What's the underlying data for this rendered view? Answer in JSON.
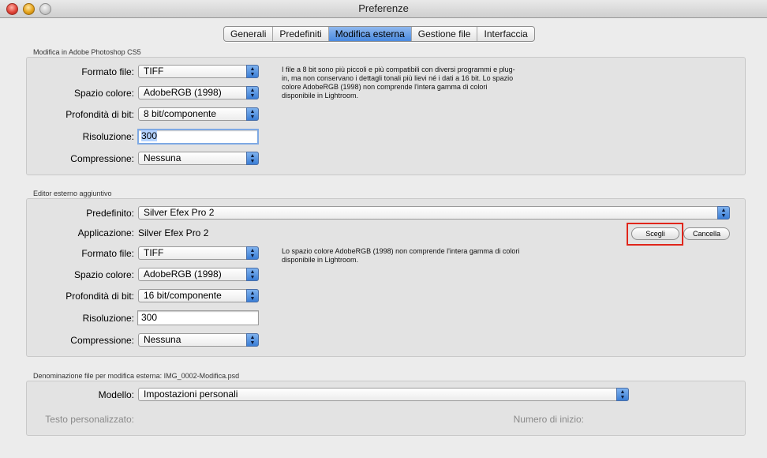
{
  "window": {
    "title": "Preferenze"
  },
  "tabs": [
    {
      "label": "Generali"
    },
    {
      "label": "Predefiniti"
    },
    {
      "label": "Modifica esterna"
    },
    {
      "label": "Gestione file"
    },
    {
      "label": "Interfaccia"
    }
  ],
  "photoshop": {
    "section_title": "Modifica in Adobe Photoshop CS5",
    "format_label": "Formato file:",
    "format_value": "TIFF",
    "colorspace_label": "Spazio colore:",
    "colorspace_value": "AdobeRGB (1998)",
    "depth_label": "Profondità di bit:",
    "depth_value": "8 bit/componente",
    "resolution_label": "Risoluzione:",
    "resolution_value": "300",
    "compression_label": "Compressione:",
    "compression_value": "Nessuna",
    "description": "I file a 8 bit sono più piccoli e più compatibili con diversi programmi e plug-in, ma non conservano i dettagli tonali più lievi né i dati a 16 bit. Lo spazio colore AdobeRGB (1998) non comprende l'intera gamma di colori disponibile in Lightroom."
  },
  "external": {
    "section_title": "Editor esterno aggiuntivo",
    "preset_label": "Predefinito:",
    "preset_value": "Silver Efex Pro 2",
    "application_label": "Applicazione:",
    "application_value": "Silver Efex Pro 2",
    "choose_button": "Scegli",
    "clear_button": "Cancella",
    "format_label": "Formato file:",
    "format_value": "TIFF",
    "colorspace_label": "Spazio colore:",
    "colorspace_value": "AdobeRGB (1998)",
    "depth_label": "Profondità di bit:",
    "depth_value": "16 bit/componente",
    "resolution_label": "Risoluzione:",
    "resolution_value": "300",
    "compression_label": "Compressione:",
    "compression_value": "Nessuna",
    "description": "Lo spazio colore AdobeRGB (1998) non comprende l'intera gamma di colori disponibile in Lightroom."
  },
  "naming": {
    "section_title": "Denominazione file per modifica esterna: IMG_0002-Modifica.psd",
    "template_label": "Modello:",
    "template_value": "Impostazioni personali",
    "custom_text_label": "Testo personalizzato:",
    "start_number_label": "Numero di inizio:"
  },
  "colors": {
    "highlight": "#e0261b",
    "accent": "#4a8ae0"
  }
}
